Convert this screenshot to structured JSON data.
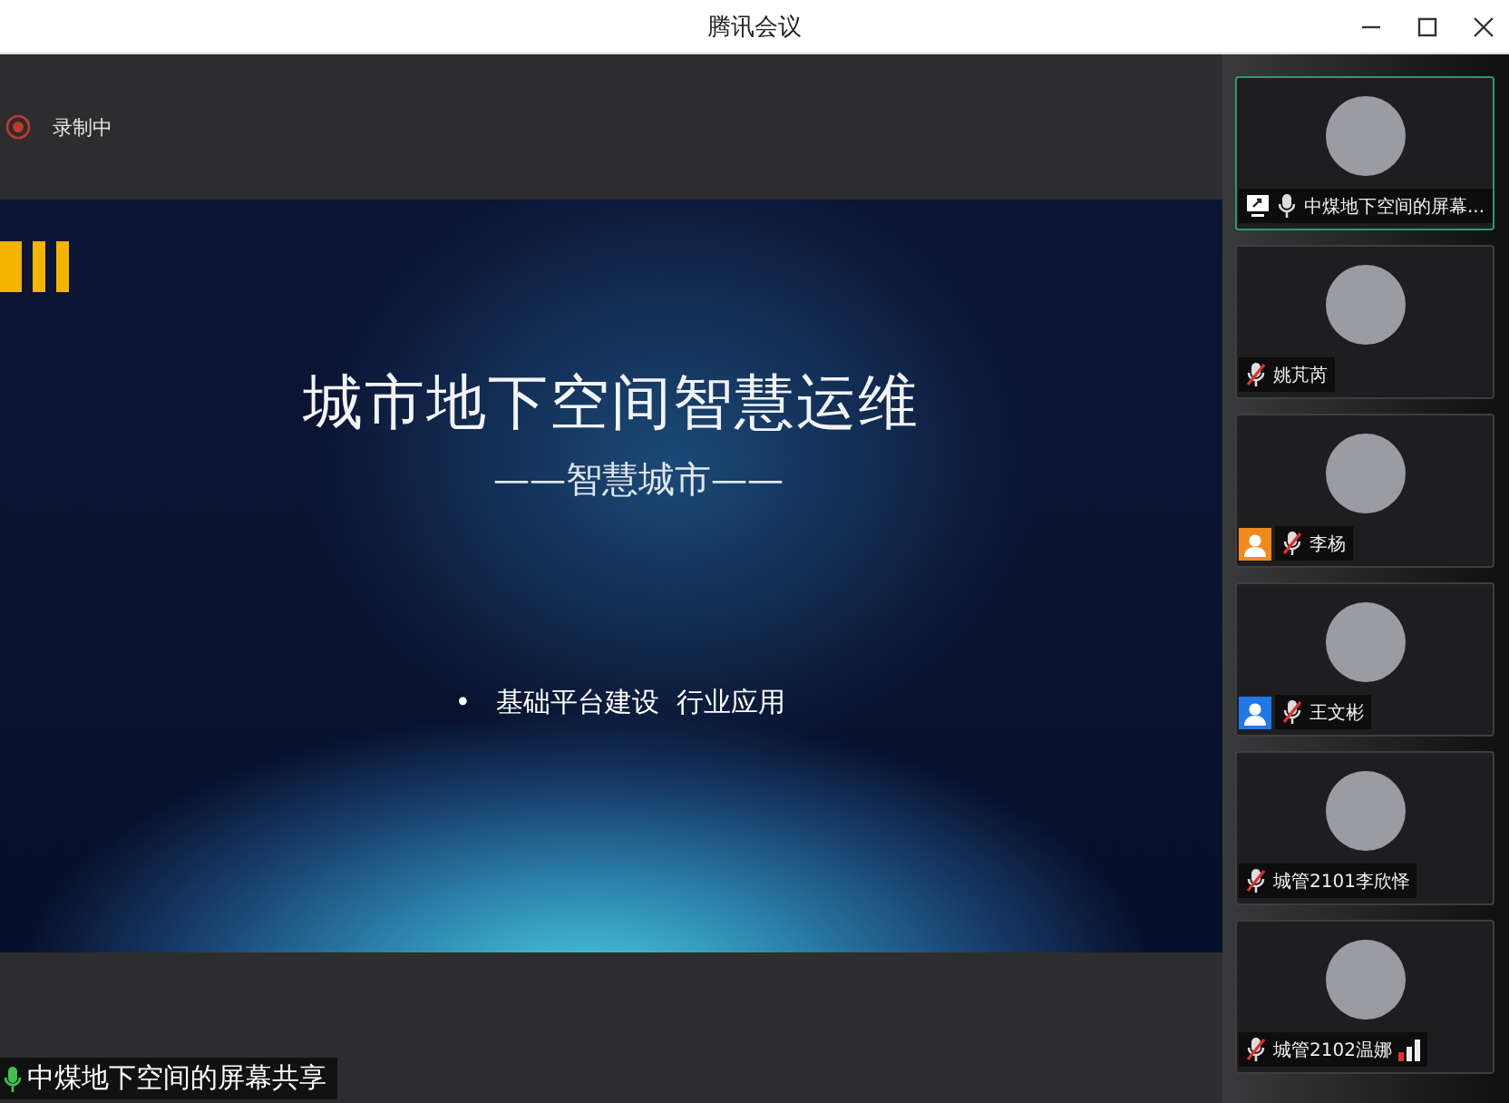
{
  "window": {
    "title": "腾讯会议"
  },
  "recording": {
    "label": "录制中"
  },
  "slide": {
    "title": "城市地下空间智慧运维",
    "subtitle": "——智慧城市——",
    "bullet": "•",
    "bullet_text": "基础平台建设  行业应用"
  },
  "speaker_label": {
    "text": "中煤地下空间的屏幕共享"
  },
  "participants": [
    {
      "name": "中煤地下空间的屏幕...",
      "selected": true,
      "muted": false,
      "sharing": true,
      "signal": false,
      "host": false,
      "cohost": false
    },
    {
      "name": "姚芃芮",
      "selected": false,
      "muted": true,
      "sharing": false,
      "signal": false,
      "host": false,
      "cohost": false
    },
    {
      "name": "李杨",
      "selected": false,
      "muted": true,
      "sharing": false,
      "signal": false,
      "host": true,
      "cohost": false
    },
    {
      "name": "王文彬",
      "selected": false,
      "muted": true,
      "sharing": false,
      "signal": false,
      "host": false,
      "cohost": true
    },
    {
      "name": "城管2101李欣怿",
      "selected": false,
      "muted": true,
      "sharing": false,
      "signal": false,
      "host": false,
      "cohost": false
    },
    {
      "name": "城管2102温娜",
      "selected": false,
      "muted": true,
      "sharing": false,
      "signal": true,
      "host": false,
      "cohost": false
    }
  ]
}
